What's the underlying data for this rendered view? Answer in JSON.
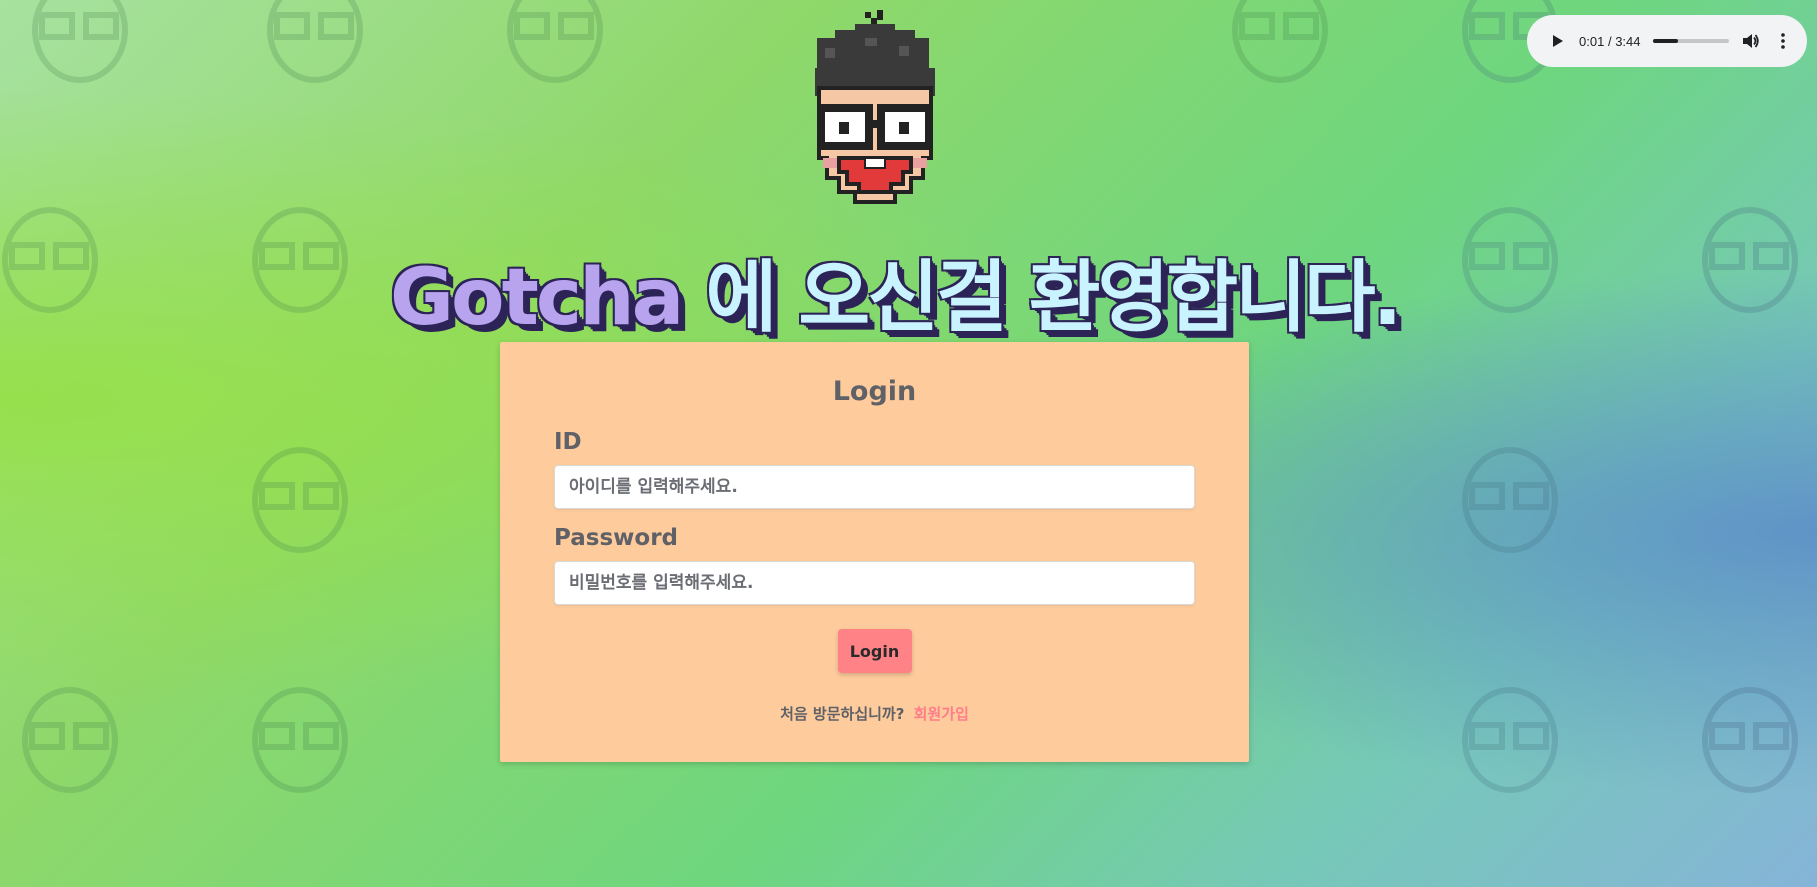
{
  "audio_player": {
    "current_time": "0:01",
    "separator": "/",
    "duration": "3:44",
    "progress_fraction": 0.33,
    "play_icon": "play-icon",
    "volume_icon": "volume-icon",
    "more_icon": "more-vertical-icon"
  },
  "mascot": {
    "icon": "pixel-mascot-face"
  },
  "header": {
    "brand": "Gotcha",
    "welcome_text": " 에 오신걸 환영합니다."
  },
  "login_form": {
    "title": "Login",
    "id_label": "ID",
    "id_placeholder": "아이디를 입력해주세요.",
    "password_label": "Password",
    "password_placeholder": "비밀번호를 입력해주세요.",
    "login_button": "Login",
    "signup_prompt": "처음 방문하십니까?",
    "signup_link": "회원가입"
  },
  "colors": {
    "card_bg": "#fecb9c",
    "button_bg": "#ff8286",
    "link": "#ff7d8a",
    "title_outline": "#2c2357"
  }
}
